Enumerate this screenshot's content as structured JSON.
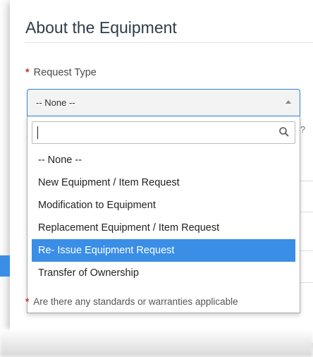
{
  "section": {
    "title": "About the Equipment"
  },
  "field": {
    "label": "Request Type",
    "required_marker": "*",
    "selected_value": "-- None --"
  },
  "search": {
    "value": ""
  },
  "options": [
    {
      "label": "-- None --",
      "selected": false
    },
    {
      "label": "New Equipment / Item Request",
      "selected": false
    },
    {
      "label": "Modification to Equipment",
      "selected": false
    },
    {
      "label": "Replacement Equipment / Item Request",
      "selected": false
    },
    {
      "label": "Re- Issue Equipment Request",
      "selected": true
    },
    {
      "label": "Transfer of Ownership",
      "selected": false
    }
  ],
  "background": {
    "partial_question": "nt?",
    "bottom_required_marker": "*",
    "bottom_question": "Are there any standards or warranties applicable"
  },
  "colors": {
    "accent": "#3a8ee6",
    "required": "#c0392b"
  }
}
